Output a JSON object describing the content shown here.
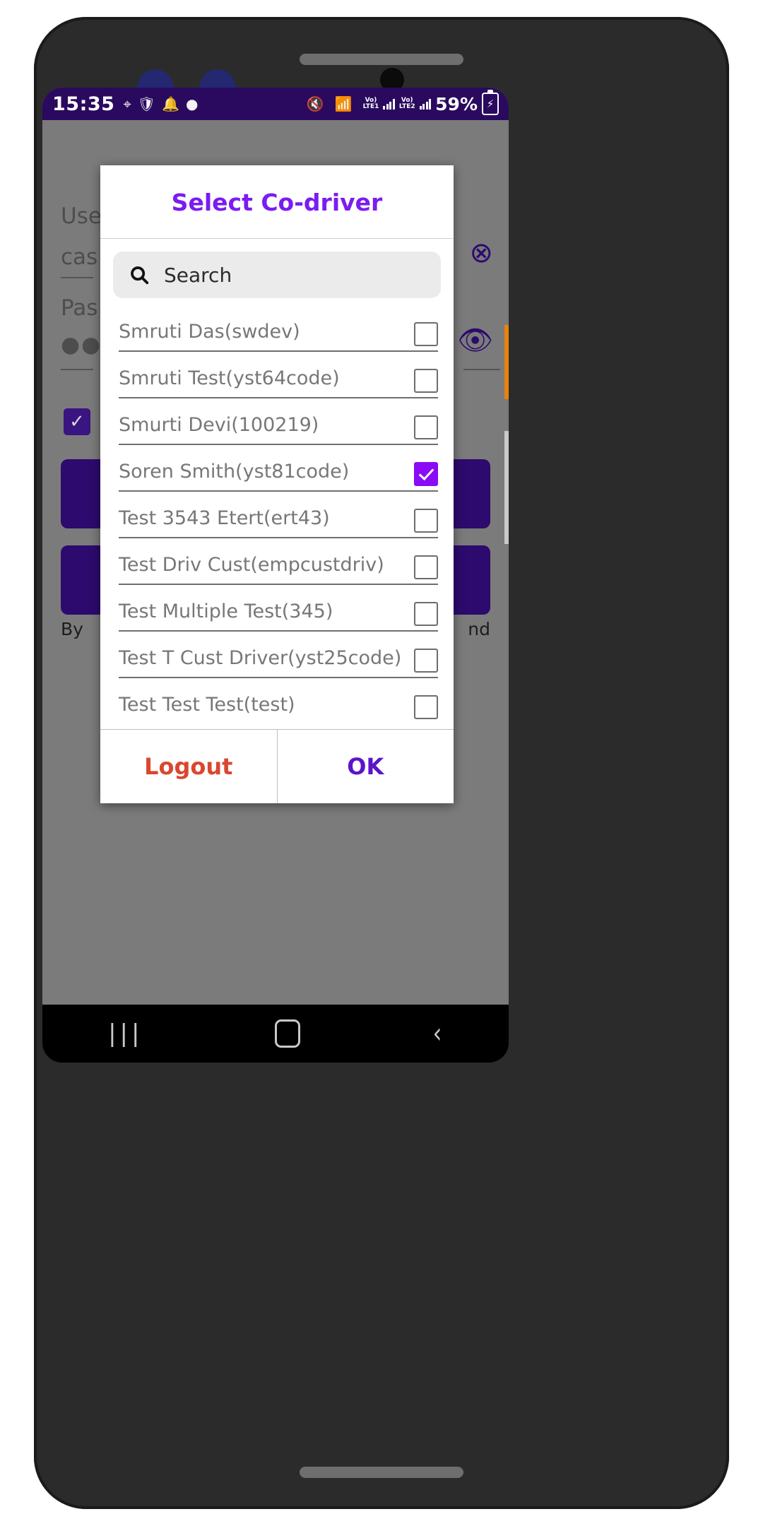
{
  "status_bar": {
    "time": "15:35",
    "left_icons": [
      "location-icon",
      "shield-icon",
      "bell-icon",
      "dot-icon"
    ],
    "mute_icon": "volume-mute-icon",
    "wifi_icon": "wifi-icon",
    "sim1_label": "Vo)",
    "sim1_sub": "LTE1",
    "sim2_label": "Vo)",
    "sim2_sub": "LTE2",
    "battery_percent": "59%",
    "battery_icon": "battery-charging-icon",
    "bg_color": "#2a0a5e"
  },
  "dialog": {
    "title": "Select Co-driver",
    "title_color": "#7b1cf0",
    "search": {
      "placeholder": "Search",
      "value": "",
      "icon": "search-icon"
    },
    "items": [
      {
        "label": "Smruti Das(swdev)",
        "checked": false
      },
      {
        "label": "Smruti Test(yst64code)",
        "checked": false
      },
      {
        "label": "Smurti Devi(100219)",
        "checked": false
      },
      {
        "label": "Soren Smith(yst81code)",
        "checked": true
      },
      {
        "label": "Test 3543 Etert(ert43)",
        "checked": false
      },
      {
        "label": "Test Driv Cust(empcustdriv)",
        "checked": false
      },
      {
        "label": "Test Multiple Test(345)",
        "checked": false
      },
      {
        "label": "Test T Cust Driver(yst25code)",
        "checked": false
      },
      {
        "label": "Test Test Test(test)",
        "checked": false
      }
    ],
    "footer": {
      "logout_label": "Logout",
      "logout_color": "#d9472f",
      "ok_label": "OK",
      "ok_color": "#5b14c9"
    },
    "checked_color": "#8a0bf5"
  },
  "background_app": {
    "username_label": "Use",
    "username_value": "cas",
    "password_label": "Pas",
    "password_value": "●●●●",
    "clear_icon": "clear-circle-icon",
    "eye_icon": "eye-icon",
    "remember_checkbox": "✓",
    "consent_left": "By",
    "consent_right": "nd"
  },
  "nav_bar": {
    "recent_icon": "recent-apps-icon",
    "home_icon": "home-icon",
    "back_icon": "back-icon"
  }
}
